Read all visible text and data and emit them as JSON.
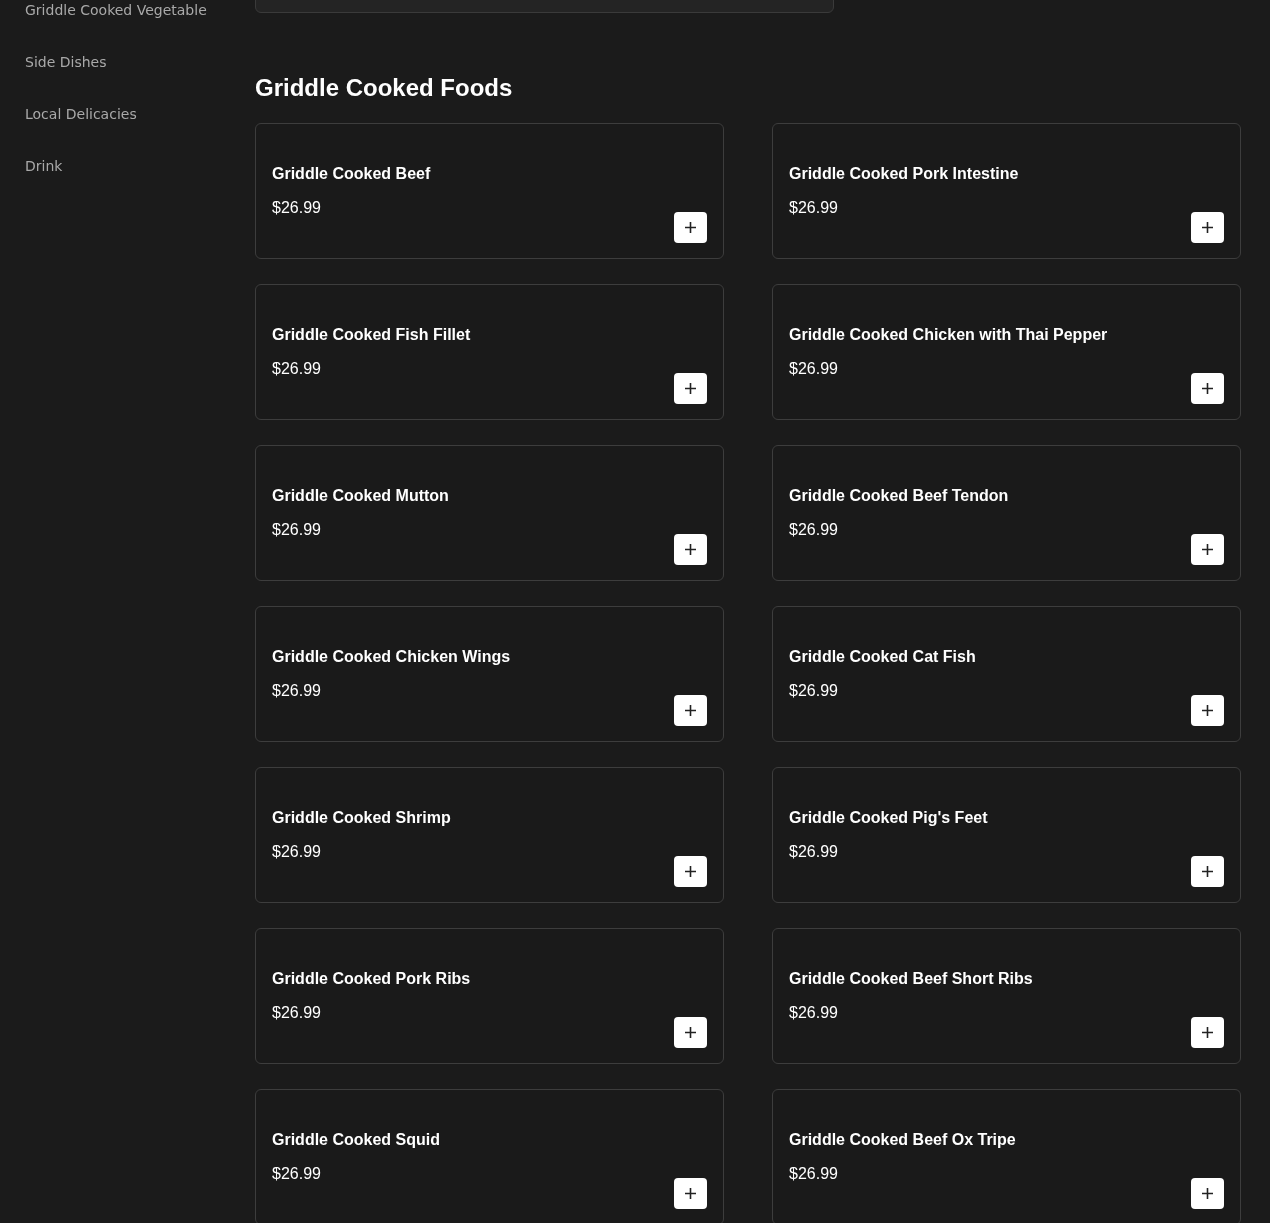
{
  "sidebar": {
    "items": [
      {
        "label": "Griddle Cooked Vegetable"
      },
      {
        "label": "Side Dishes"
      },
      {
        "label": "Local Delicacies"
      },
      {
        "label": "Drink"
      }
    ]
  },
  "section": {
    "title": "Griddle Cooked Foods",
    "items": [
      {
        "name": "Griddle Cooked Beef",
        "price": "$26.99"
      },
      {
        "name": "Griddle Cooked Pork Intestine",
        "price": "$26.99"
      },
      {
        "name": "Griddle Cooked Fish Fillet",
        "price": "$26.99"
      },
      {
        "name": "Griddle Cooked Chicken with Thai Pepper",
        "price": "$26.99"
      },
      {
        "name": "Griddle Cooked Mutton",
        "price": "$26.99"
      },
      {
        "name": "Griddle Cooked Beef Tendon",
        "price": "$26.99"
      },
      {
        "name": "Griddle Cooked Chicken Wings",
        "price": "$26.99"
      },
      {
        "name": "Griddle Cooked Cat Fish",
        "price": "$26.99"
      },
      {
        "name": "Griddle Cooked Shrimp",
        "price": "$26.99"
      },
      {
        "name": "Griddle Cooked Pig's Feet",
        "price": "$26.99"
      },
      {
        "name": "Griddle Cooked Pork Ribs",
        "price": "$26.99"
      },
      {
        "name": "Griddle Cooked Beef Short Ribs",
        "price": "$26.99"
      },
      {
        "name": "Griddle Cooked Squid",
        "price": "$26.99"
      },
      {
        "name": "Griddle Cooked Beef Ox Tripe",
        "price": "$26.99"
      }
    ]
  }
}
